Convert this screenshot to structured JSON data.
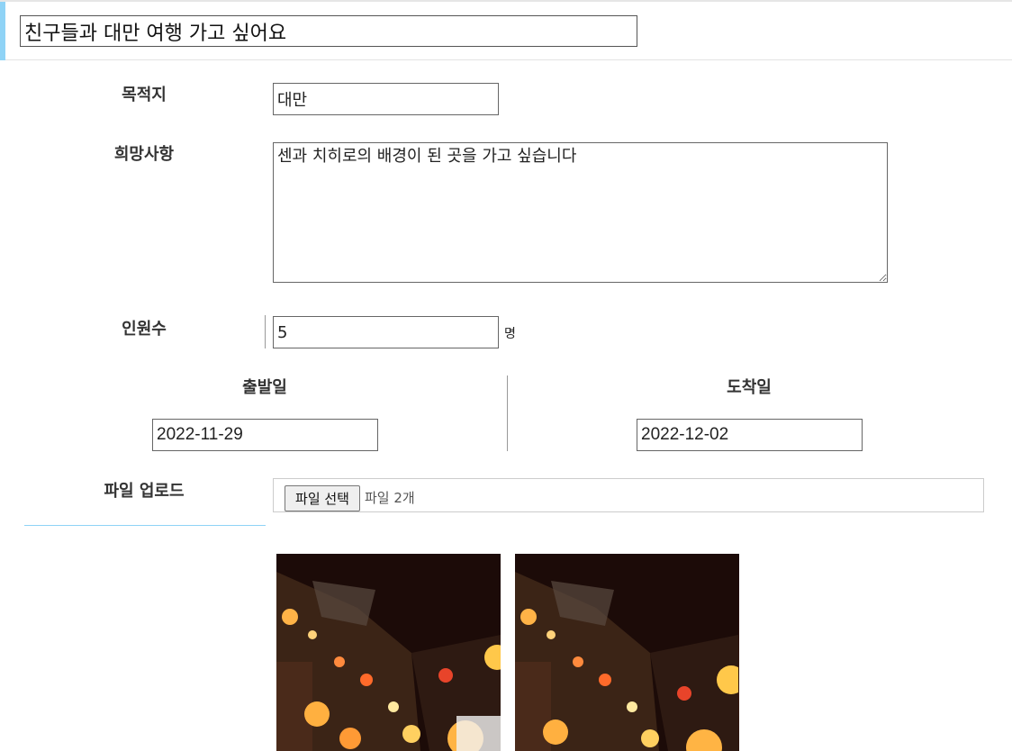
{
  "header": {
    "title_value": "친구들과 대만 여행 가고 싶어요"
  },
  "form": {
    "destination": {
      "label": "목적지",
      "value": "대만"
    },
    "wishes": {
      "label": "희망사항",
      "value": "센과 치히로의 배경이 된 곳을 가고 싶습니다"
    },
    "headcount": {
      "label": "인원수",
      "value": "5",
      "unit": "명"
    },
    "departure": {
      "label": "출발일",
      "value": "2022-11-29"
    },
    "arrival": {
      "label": "도착일",
      "value": "2022-12-02"
    },
    "upload": {
      "label": "파일 업로드",
      "button_label": "파일 선택",
      "status": "파일 2개"
    }
  },
  "previews": [
    {
      "description": "lantern-street-photo-1"
    },
    {
      "description": "lantern-street-photo-2"
    }
  ],
  "colors": {
    "accent": "#8fd3f6",
    "border": "#666666",
    "label_text": "#333333"
  }
}
